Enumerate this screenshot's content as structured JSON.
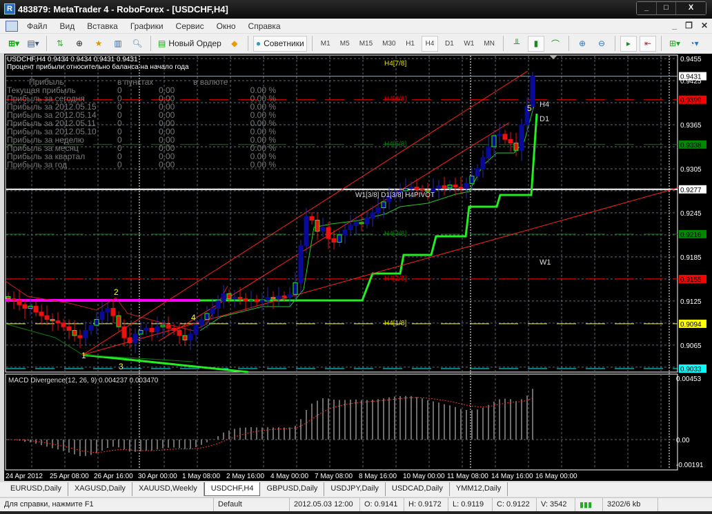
{
  "window": {
    "title": "483879: MetaTrader 4 - RoboForex - [USDCHF,H4]",
    "minimize": "_",
    "maximize": "□",
    "close": "X"
  },
  "menu": [
    "Файл",
    "Вид",
    "Вставка",
    "Графики",
    "Сервис",
    "Окно",
    "Справка"
  ],
  "toolbar": {
    "new_order": "Новый Ордер",
    "experts": "Советники",
    "timeframes": [
      "M1",
      "M5",
      "M15",
      "M30",
      "H1",
      "H4",
      "D1",
      "W1",
      "MN"
    ],
    "active_timeframe": "H4"
  },
  "chart": {
    "header": "USDCHF,H4  0.9434 0.9434 0.9431 0.9431",
    "subtitle": "Процент прибыли относительно баланса на начало года",
    "profit_table": {
      "headers": [
        "Прибыль",
        "в пунктах",
        "в валюте"
      ],
      "rows": [
        [
          "Текущая прибыль",
          "0",
          "0.00",
          "0.00 %"
        ],
        [
          "Прибыль за сегодня",
          "0",
          "0.00",
          "0.00 %"
        ],
        [
          "Прибыль за 2012.05.15",
          "0",
          "0.00",
          "0.00 %"
        ],
        [
          "Прибыль за 2012.05.14",
          "0",
          "0.00",
          "0.00 %"
        ],
        [
          "Прибыль за 2012.05.11",
          "0",
          "0.00",
          "0.00 %"
        ],
        [
          "Прибыль за 2012.05.10",
          "0",
          "0.00",
          "0.00 %"
        ],
        [
          "Прибыль за неделю",
          "0",
          "0.00",
          "0.00 %"
        ],
        [
          "Прибыль за месяц",
          "0",
          "0.00",
          "0.00 %"
        ],
        [
          "Прибыль за квартал",
          "0",
          "0.00",
          "0.00 %"
        ],
        [
          "Прибыль за год",
          "0",
          "0.00",
          "0.00 %"
        ]
      ]
    },
    "murrey_labels": [
      {
        "text": "H4[7/8]",
        "price": 0.9455,
        "color": "#e0e000"
      },
      {
        "text": "H4[6/8]",
        "price": 0.9399,
        "color": "#e00000"
      },
      {
        "text": "H4[5/8]",
        "price": 0.9338,
        "color": "#008000"
      },
      {
        "text": "H4[3/8]",
        "price": 0.9216,
        "color": "#008000"
      },
      {
        "text": "H4[2/8]",
        "price": 0.9155,
        "color": "#e00000"
      },
      {
        "text": "H4[1/8]",
        "price": 0.9094,
        "color": "#e0e000"
      }
    ],
    "pivot_label": "W1[3/8] D1[3/8] H4PIVOT",
    "trend_labels": [
      "H4",
      "D1",
      "W1"
    ],
    "wave_labels": [
      "1",
      "2",
      "3",
      "4",
      "5"
    ],
    "levels": [
      {
        "price": 0.9431,
        "color": "#ffffff",
        "style": "solid"
      },
      {
        "price": 0.9399,
        "color": "#ff0000",
        "style": "dash"
      },
      {
        "price": 0.9338,
        "color": "#008000",
        "style": "dash"
      },
      {
        "price": 0.9277,
        "color": "#ffffff",
        "style": "thick"
      },
      {
        "price": 0.9216,
        "color": "#008000",
        "style": "dash"
      },
      {
        "price": 0.9155,
        "color": "#ff0000",
        "style": "dash"
      },
      {
        "price": 0.9094,
        "color": "#ffff00",
        "style": "dash"
      },
      {
        "price": 0.9033,
        "color": "#00ffff",
        "style": "dash"
      }
    ],
    "price_ticks": [
      "0.9455",
      "0.9425",
      "0.9365",
      "0.9305",
      "0.9245",
      "0.9185",
      "0.9125",
      "0.9065"
    ],
    "macd_label": "MACD Divergence(12, 26, 9) 0.004237 0.003470",
    "macd_ticks": [
      "0.00453",
      "0.00",
      "-0.00191"
    ],
    "time_ticks": [
      "24 Apr 2012",
      "25 Apr 08:00",
      "26 Apr 16:00",
      "30 Apr 00:00",
      "1 May 08:00",
      "2 May 16:00",
      "4 May 00:00",
      "7 May 08:00",
      "8 May 16:00",
      "10 May 00:00",
      "11 May 08:00",
      "14 May 16:00",
      "16 May 00:00"
    ]
  },
  "chart_data": {
    "type": "candlestick",
    "symbol": "USDCHF",
    "timeframe": "H4",
    "ylim": [
      0.9033,
      0.9455
    ],
    "closes": [
      0.9128,
      0.9126,
      0.912,
      0.9115,
      0.9118,
      0.911,
      0.9105,
      0.91,
      0.9098,
      0.9095,
      0.909,
      0.9085,
      0.9078,
      0.9075,
      0.9085,
      0.9092,
      0.91,
      0.911,
      0.9115,
      0.9105,
      0.909,
      0.9075,
      0.9068,
      0.908,
      0.9085,
      0.9088,
      0.9083,
      0.909,
      0.9092,
      0.9088,
      0.9085,
      0.9078,
      0.9072,
      0.908,
      0.9092,
      0.91,
      0.9108,
      0.9115,
      0.9125,
      0.9135,
      0.9128,
      0.913,
      0.9128,
      0.9125,
      0.9127,
      0.9124,
      0.9126,
      0.913,
      0.9128,
      0.9132,
      0.913,
      0.9134,
      0.915,
      0.92,
      0.924,
      0.9235,
      0.922,
      0.9225,
      0.921,
      0.9205,
      0.9215,
      0.9222,
      0.9228,
      0.9232,
      0.923,
      0.9238,
      0.9245,
      0.9252,
      0.926,
      0.9268,
      0.9272,
      0.9275,
      0.9278,
      0.928,
      0.9277,
      0.9276,
      0.9274,
      0.9278,
      0.9282,
      0.9279,
      0.9283,
      0.928,
      0.9278,
      0.9285,
      0.9295,
      0.9305,
      0.932,
      0.9335,
      0.935,
      0.9352,
      0.9345,
      0.934,
      0.933,
      0.9365,
      0.939,
      0.9431
    ],
    "last_price": 0.9431
  },
  "tabs": [
    {
      "label": "EURUSD,Daily"
    },
    {
      "label": "XAGUSD,Daily"
    },
    {
      "label": "XAUUSD,Weekly"
    },
    {
      "label": "USDCHF,H4",
      "active": true
    },
    {
      "label": "GBPUSD,Daily"
    },
    {
      "label": "USDJPY,Daily"
    },
    {
      "label": "USDCAD,Daily"
    },
    {
      "label": "YMM12,Daily"
    }
  ],
  "status": {
    "help": "Для справки, нажмите F1",
    "profile": "Default",
    "time": "2012.05.03 12:00",
    "open": "O: 0.9141",
    "high": "H: 0.9172",
    "low": "L: 0.9119",
    "close": "C: 0.9122",
    "volume": "V: 3542",
    "traffic": "3202/6 kb"
  }
}
